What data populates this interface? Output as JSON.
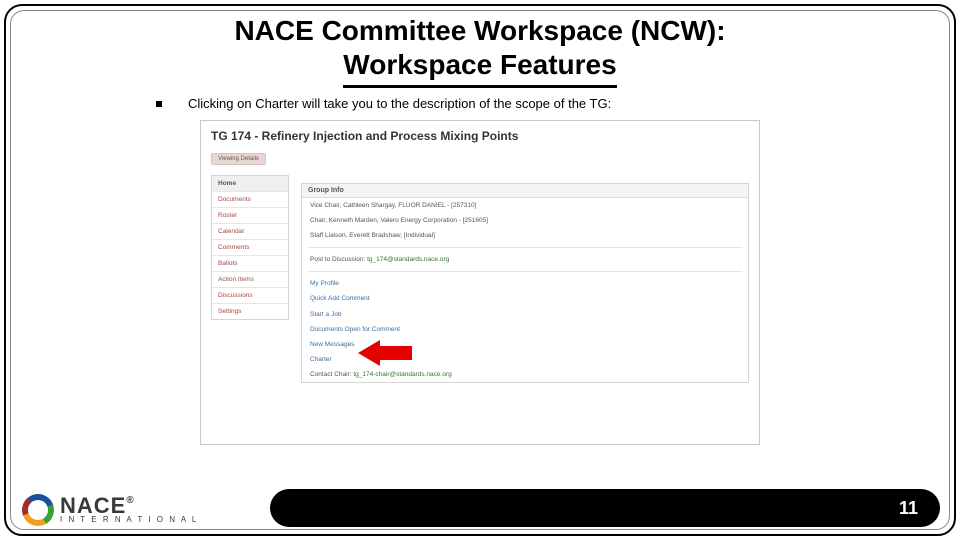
{
  "title_line1": "NACE Committee Workspace (NCW):",
  "title_line2": "Workspace Features",
  "bullet": "Clicking on Charter will take you to the description of the scope of the TG:",
  "shot": {
    "tg_title": "TG 174 - Refinery Injection and Process Mixing Points",
    "chip": "Viewing Details",
    "sidebar": {
      "items": [
        {
          "label": "Home",
          "active": true
        },
        {
          "label": "Documents"
        },
        {
          "label": "Roster"
        },
        {
          "label": "Calendar"
        },
        {
          "label": "Comments"
        },
        {
          "label": "Ballots"
        },
        {
          "label": "Action Items"
        },
        {
          "label": "Discussions"
        },
        {
          "label": "Settings"
        }
      ]
    },
    "group": {
      "header": "Group Info",
      "vice": "Vice Chair, Cathleen Shargay, FLUOR DANIEL - [257310]",
      "chair": "Chair, Kenneth Marden, Valero Energy Corporation - [251605]",
      "staff": "Staff Liaison, Everett Bradshaw, [Individual]",
      "post_lbl": "Post to Discussion:",
      "post_mail": "tg_174@standards.nace.org",
      "links": [
        "My Profile",
        "Quick Add Comment",
        "Start a Job",
        "Documents Open for Comment",
        "New Messages",
        "Charter"
      ],
      "contact_lbl": "Contact Chair:",
      "contact_mail": "tg_174-chair@standards.nace.org"
    }
  },
  "logo": {
    "brand": "NACE",
    "reg": "®",
    "sub": "I N T E R N A T I O N A L"
  },
  "page_number": "11"
}
